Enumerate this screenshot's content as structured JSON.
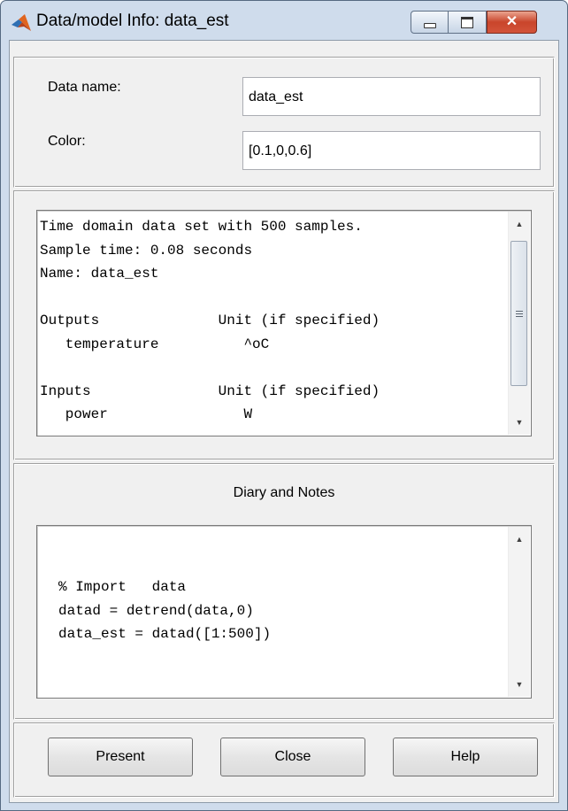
{
  "window": {
    "title": "Data/model Info: data_est"
  },
  "fields": {
    "data_name_label": "Data name:",
    "data_name_value": "data_est",
    "color_label": "Color:",
    "color_value": "[0.1,0,0.6]"
  },
  "info": {
    "lines": [
      "Time domain data set with 500 samples.",
      "Sample time: 0.08 seconds",
      "Name: data_est",
      "",
      "Outputs              Unit (if specified)",
      "   temperature          ^oC",
      "",
      "Inputs               Unit (if specified)",
      "   power                W"
    ]
  },
  "diary": {
    "heading": "Diary and Notes",
    "lines": [
      "% Import   data",
      "datad = detrend(data,0)",
      "data_est = datad([1:500])"
    ]
  },
  "buttons": {
    "present": "Present",
    "close": "Close",
    "help": "Help"
  },
  "icons": {
    "app": "matlab-membrane-icon",
    "minimize": "minimize-icon",
    "maximize": "maximize-icon",
    "close": "close-icon"
  }
}
